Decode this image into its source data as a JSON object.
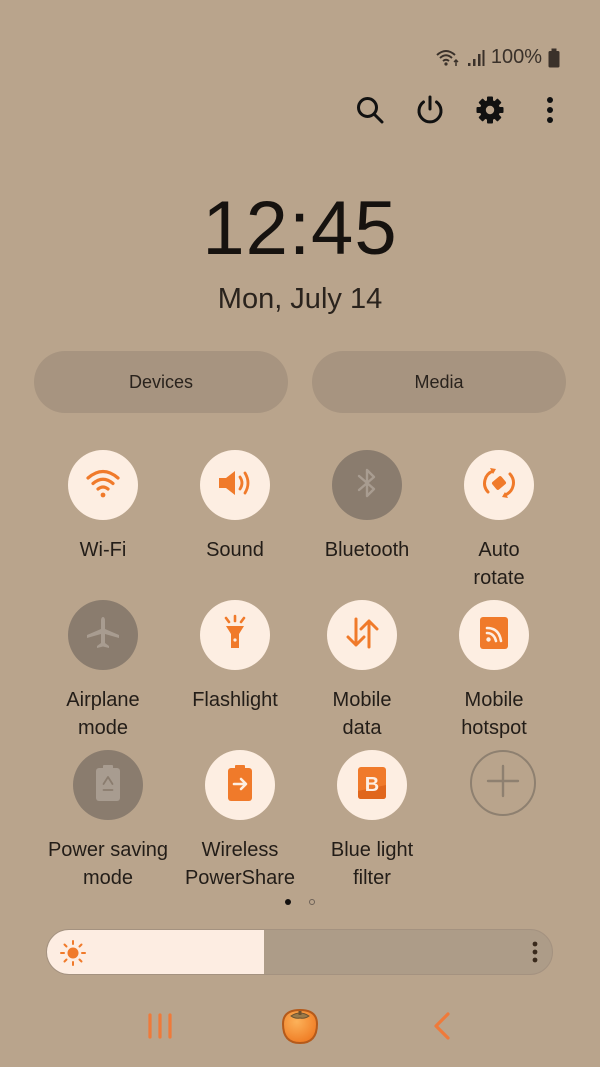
{
  "status_bar": {
    "wifi_icon": "wifi-calling-icon",
    "signal_icon": "signal-icon",
    "battery_percent": "100%",
    "battery_icon": "battery-full-icon"
  },
  "top_actions": [
    {
      "name": "search",
      "icon": "search-icon"
    },
    {
      "name": "power",
      "icon": "power-icon"
    },
    {
      "name": "settings",
      "icon": "gear-icon"
    },
    {
      "name": "more",
      "icon": "more-vertical-icon"
    }
  ],
  "clock": {
    "time": "12:45",
    "date": "Mon, July 14"
  },
  "pills": {
    "devices": "Devices",
    "media": "Media"
  },
  "tiles": [
    {
      "label_1": "Wi-Fi",
      "label_2": "",
      "state": "on",
      "icon": "wifi-icon"
    },
    {
      "label_1": "Sound",
      "label_2": "",
      "state": "on",
      "icon": "sound-icon"
    },
    {
      "label_1": "Bluetooth",
      "label_2": "",
      "state": "off",
      "icon": "bluetooth-icon"
    },
    {
      "label_1": "Auto",
      "label_2": "rotate",
      "state": "on",
      "icon": "auto-rotate-icon"
    },
    {
      "label_1": "Airplane",
      "label_2": "mode",
      "state": "off",
      "icon": "airplane-icon"
    },
    {
      "label_1": "Flashlight",
      "label_2": "",
      "state": "on",
      "icon": "flashlight-icon"
    },
    {
      "label_1": "Mobile",
      "label_2": "data",
      "state": "on",
      "icon": "mobile-data-icon"
    },
    {
      "label_1": "Mobile",
      "label_2": "hotspot",
      "state": "on",
      "icon": "hotspot-icon"
    },
    {
      "label_1": "Power saving",
      "label_2": "mode",
      "state": "off",
      "icon": "power-saving-icon"
    },
    {
      "label_1": "Wireless",
      "label_2": "PowerShare",
      "state": "on",
      "icon": "wireless-powershare-icon"
    },
    {
      "label_1": "Blue light",
      "label_2": "filter",
      "state": "on",
      "icon": "blue-light-filter-icon"
    },
    {
      "label_1": "",
      "label_2": "",
      "state": "add",
      "icon": "add-icon"
    }
  ],
  "pages": {
    "current": 1,
    "total": 2
  },
  "brightness": {
    "level_percent": 43,
    "icon": "sun-icon"
  },
  "colors": {
    "background": "#b9a48c",
    "accent": "#f07a2a",
    "tile_on": "#fdeee2",
    "tile_off": "#8a7c6e"
  },
  "nav": {
    "recents": "recents-icon",
    "home": "home-persimmon-icon",
    "back": "back-icon"
  }
}
